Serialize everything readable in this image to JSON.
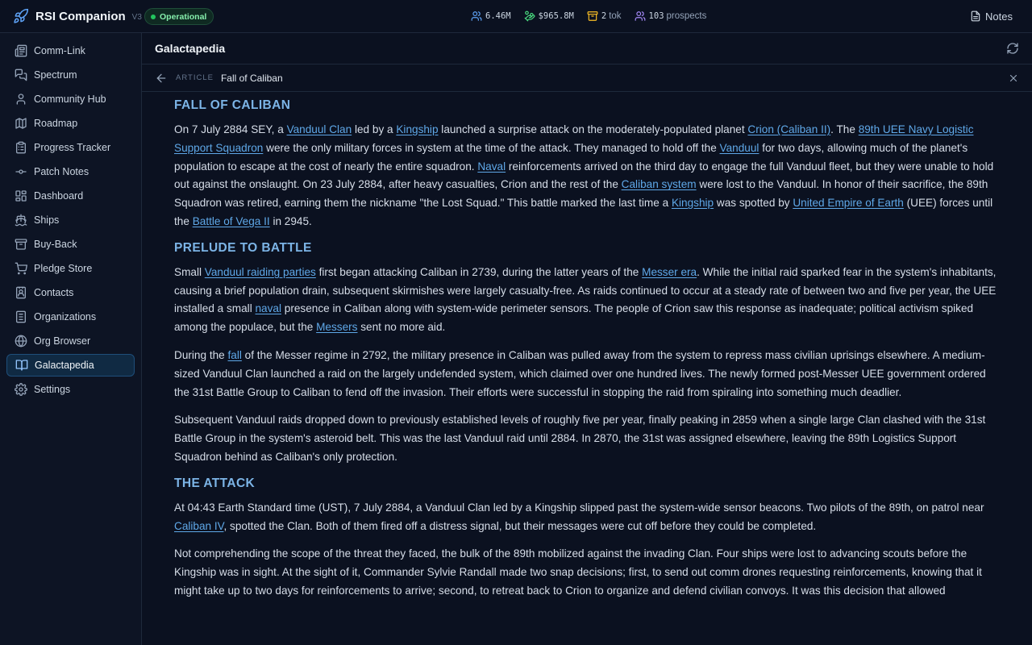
{
  "header": {
    "app_name": "RSI Companion",
    "version": "V3",
    "status": "Operational",
    "stats": [
      {
        "icon": "users-icon",
        "value": "6.46M",
        "unit": ""
      },
      {
        "icon": "money-icon",
        "value": "$965.8M",
        "unit": ""
      },
      {
        "icon": "box-icon",
        "value": "2",
        "unit": "tok"
      },
      {
        "icon": "prospects-icon",
        "value": "103",
        "unit": "prospects"
      }
    ],
    "notes_label": "Notes"
  },
  "sidebar": {
    "items": [
      {
        "label": "Comm-Link",
        "icon": "newspaper-icon"
      },
      {
        "label": "Spectrum",
        "icon": "chat-icon"
      },
      {
        "label": "Community Hub",
        "icon": "user-icon"
      },
      {
        "label": "Roadmap",
        "icon": "map-icon"
      },
      {
        "label": "Progress Tracker",
        "icon": "clipboard-icon"
      },
      {
        "label": "Patch Notes",
        "icon": "commit-icon"
      },
      {
        "label": "Dashboard",
        "icon": "grid-icon"
      },
      {
        "label": "Ships",
        "icon": "ship-icon"
      },
      {
        "label": "Buy-Back",
        "icon": "archive-icon"
      },
      {
        "label": "Pledge Store",
        "icon": "cart-icon"
      },
      {
        "label": "Contacts",
        "icon": "contact-icon"
      },
      {
        "label": "Organizations",
        "icon": "org-icon"
      },
      {
        "label": "Org Browser",
        "icon": "globe-icon"
      },
      {
        "label": "Galactapedia",
        "icon": "book-icon"
      },
      {
        "label": "Settings",
        "icon": "gear-icon"
      }
    ],
    "active": "Galactapedia"
  },
  "panel": {
    "title": "Galactapedia",
    "breadcrumb_label": "ARTICLE",
    "article_title": "Fall of Caliban"
  },
  "article": {
    "sections": [
      {
        "heading": "FALL OF CALIBAN",
        "paragraphs": [
          [
            {
              "t": "On 7 July 2884 SEY, a "
            },
            {
              "t": "Vanduul Clan",
              "link": true
            },
            {
              "t": " led by a "
            },
            {
              "t": "Kingship",
              "link": true
            },
            {
              "t": " launched a surprise attack on the moderately-populated planet "
            },
            {
              "t": "Crion (Caliban II)",
              "link": true
            },
            {
              "t": ". The "
            },
            {
              "t": "89th UEE Navy Logistic Support Squadron",
              "link": true
            },
            {
              "t": " were the only military forces in system at the time of the attack. They managed to hold off the "
            },
            {
              "t": "Vanduul",
              "link": true
            },
            {
              "t": " for two days, allowing much of the planet's population to escape at the cost of nearly the entire squadron. "
            },
            {
              "t": "Naval",
              "link": true
            },
            {
              "t": " reinforcements arrived on the third day to engage the full Vanduul fleet, but they were unable to hold out against the onslaught. On 23 July 2884, after heavy casualties, Crion and the rest of the "
            },
            {
              "t": "Caliban system",
              "link": true
            },
            {
              "t": " were lost to the Vanduul. In honor of their sacrifice, the 89th Squadron was retired, earning them the nickname \"the Lost Squad.\" This battle marked the last time a "
            },
            {
              "t": "Kingship",
              "link": true
            },
            {
              "t": " was spotted by "
            },
            {
              "t": "United Empire of Earth",
              "link": true
            },
            {
              "t": " (UEE) forces until the "
            },
            {
              "t": "Battle of Vega II",
              "link": true
            },
            {
              "t": " in 2945."
            }
          ]
        ]
      },
      {
        "heading": "PRELUDE TO BATTLE",
        "paragraphs": [
          [
            {
              "t": "Small "
            },
            {
              "t": "Vanduul raiding parties",
              "link": true
            },
            {
              "t": " first began attacking Caliban in 2739, during the latter years of the "
            },
            {
              "t": "Messer era",
              "link": true
            },
            {
              "t": ". While the initial raid sparked fear in the system's inhabitants, causing a brief population drain, subsequent skirmishes were largely casualty-free. As raids continued to occur at a steady rate of between two and five per year, the UEE installed a small "
            },
            {
              "t": "naval",
              "link": true
            },
            {
              "t": " presence in Caliban along with system-wide perimeter sensors. The people of Crion saw this response as inadequate; political activism spiked among the populace, but the "
            },
            {
              "t": "Messers",
              "link": true
            },
            {
              "t": " sent no more aid."
            }
          ],
          [
            {
              "t": "During the "
            },
            {
              "t": "fall",
              "link": true
            },
            {
              "t": " of the Messer regime in 2792, the military presence in Caliban was pulled away from the system to repress mass civilian uprisings elsewhere. A medium-sized Vanduul Clan launched a raid on the largely undefended system, which claimed over one hundred lives. The newly formed post-Messer UEE government ordered the 31st Battle Group to Caliban to fend off the invasion. Their efforts were successful in stopping the raid from spiraling into something much deadlier."
            }
          ],
          [
            {
              "t": "Subsequent Vanduul raids dropped down to previously established levels of roughly five per year, finally peaking in 2859 when a single large Clan clashed with the 31st Battle Group in the system's asteroid belt. This was the last Vanduul raid until 2884. In 2870, the 31st was assigned elsewhere, leaving the 89th Logistics Support Squadron behind as Caliban's only protection."
            }
          ]
        ]
      },
      {
        "heading": "THE ATTACK",
        "paragraphs": [
          [
            {
              "t": "At 04:43 Earth Standard time (UST), 7 July 2884, a Vanduul Clan led by a Kingship slipped past the system-wide sensor beacons. Two pilots of the 89th, on patrol near "
            },
            {
              "t": "Caliban IV",
              "link": true
            },
            {
              "t": ", spotted the Clan. Both of them fired off a distress signal, but their messages were cut off before they could be completed."
            }
          ],
          [
            {
              "t": "Not comprehending the scope of the threat they faced, the bulk of the 89th mobilized against the invading Clan. Four ships were lost to advancing scouts before the Kingship was in sight. At the sight of it, Commander Sylvie Randall made two snap decisions; first, to send out comm drones requesting reinforcements, knowing that it might take up to two days for reinforcements to arrive; second, to retreat back to Crion to organize and defend civilian convoys. It was this decision that allowed"
            }
          ]
        ]
      }
    ]
  },
  "colors": {
    "background": "#0b1120",
    "accent": "#5fa8e8",
    "heading": "#7cb4e6",
    "status_green": "#22c55e"
  }
}
